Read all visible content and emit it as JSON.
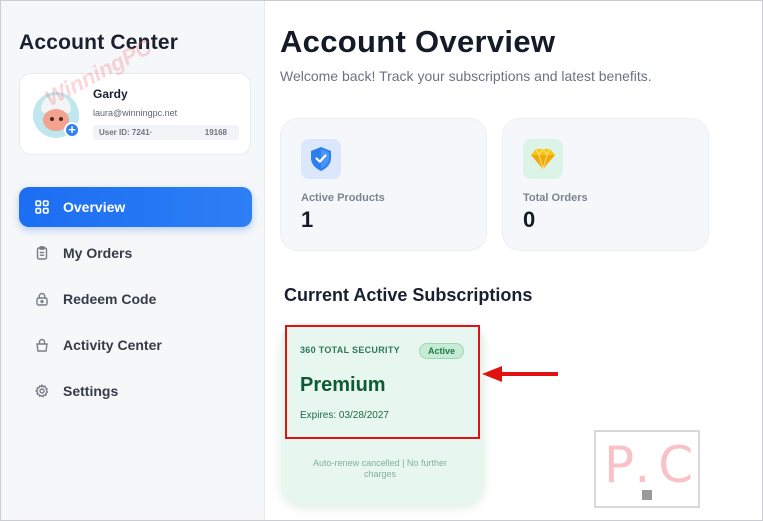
{
  "sidebar": {
    "title": "Account Center",
    "profile": {
      "name": "Gardy",
      "email": "laura@winningpc.net",
      "user_id_start": "User ID: 7241·",
      "user_id_end": "19168"
    },
    "watermark": "WinningPC",
    "items": [
      {
        "label": "Overview",
        "icon": "grid-icon",
        "active": true
      },
      {
        "label": "My Orders",
        "icon": "clipboard-icon",
        "active": false
      },
      {
        "label": "Redeem Code",
        "icon": "lock-icon",
        "active": false
      },
      {
        "label": "Activity Center",
        "icon": "bag-icon",
        "active": false
      },
      {
        "label": "Settings",
        "icon": "gear-icon",
        "active": false
      }
    ]
  },
  "main": {
    "title": "Account Overview",
    "subtitle": "Welcome back! Track your subscriptions and latest benefits.",
    "stats": [
      {
        "label": "Active Products",
        "value": "1",
        "icon": "shield-icon"
      },
      {
        "label": "Total Orders",
        "value": "0",
        "icon": "diamond-icon"
      }
    ],
    "section_title": "Current Active Subscriptions",
    "subscription": {
      "product": "360 TOTAL SECURITY",
      "status": "Active",
      "plan": "Premium",
      "expiry": "Expires: 03/28/2027",
      "note": "Auto-renew cancelled | No further charges"
    }
  },
  "logo_text": "P.C",
  "colors": {
    "accent": "#1c6ef2",
    "highlight": "#e01212",
    "subscription_bg": "#e7f6ee"
  }
}
